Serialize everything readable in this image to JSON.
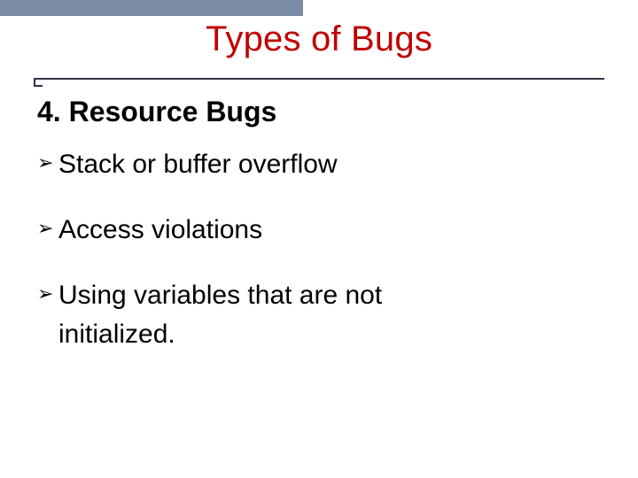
{
  "title": "Types of Bugs",
  "subheading": "4. Resource Bugs",
  "bullets": [
    {
      "text": "Stack or buffer overflow"
    },
    {
      "text": "Access violations"
    },
    {
      "line1": "Using variables that are not",
      "line2": "initialized."
    }
  ],
  "icons": {
    "bullet": "➢"
  }
}
